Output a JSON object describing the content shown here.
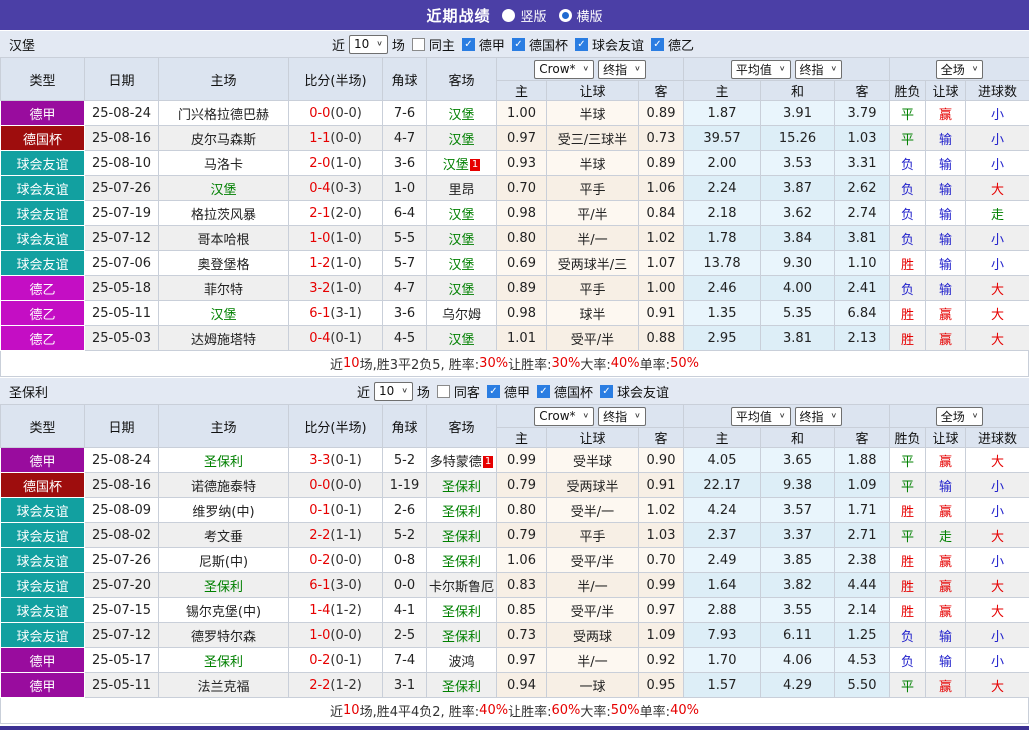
{
  "titlebar": {
    "title": "近期战绩",
    "radios": [
      {
        "label": "竖版",
        "checked": false
      },
      {
        "label": "横版",
        "checked": true
      }
    ]
  },
  "colors": {
    "topbar": "#4b3fa6",
    "type_colors": {
      "德甲": "#990c9e",
      "德国杯": "#9e0d0d",
      "球会友谊": "#12a0a0",
      "德乙": "#c40ec4"
    },
    "value_colors": {
      "胜": "#e60000",
      "平": "#008000",
      "负": "#2323cc",
      "赢": "#e60000",
      "输": "#2323cc",
      "走": "#008000",
      "大": "#e60000",
      "小": "#2323cc"
    },
    "team_link": "#008000",
    "score_ft": "#e60000",
    "summary_red": "#e60000"
  },
  "filter_labels": {
    "near": "近",
    "count": "10",
    "games": "场"
  },
  "column_headers": {
    "type": "类型",
    "date": "日期",
    "home": "主场",
    "score": "比分(半场)",
    "corner": "角球",
    "away": "客场",
    "odds_sub": [
      "主",
      "让球",
      "客"
    ],
    "avg_sub": [
      "主",
      "和",
      "客"
    ],
    "full_sub": [
      "胜负",
      "让球",
      "进球数"
    ]
  },
  "dropdowns": {
    "odds_a": "Crow*",
    "odds_b": "终指",
    "avg_a": "平均值",
    "avg_b": "终指",
    "full": "全场"
  },
  "sections": [
    {
      "team": "汉堡",
      "same_checkbox": {
        "label": "同主",
        "checked": false
      },
      "league_checkboxes": [
        {
          "label": "德甲",
          "checked": true
        },
        {
          "label": "德国杯",
          "checked": true
        },
        {
          "label": "球会友谊",
          "checked": true
        },
        {
          "label": "德乙",
          "checked": true
        }
      ],
      "rows": [
        {
          "type": "德甲",
          "date": "25-08-24",
          "home": "门兴格拉德巴赫",
          "home_team": false,
          "ft": "0-0",
          "ht": "(0-0)",
          "corner": "7-6",
          "away": "汉堡",
          "away_team": true,
          "away_card": "",
          "odds": [
            "1.00",
            "半球",
            "0.89"
          ],
          "avg": [
            "1.87",
            "3.91",
            "3.79"
          ],
          "full": [
            "平",
            "赢",
            "小"
          ]
        },
        {
          "type": "德国杯",
          "date": "25-08-16",
          "home": "皮尔马森斯",
          "home_team": false,
          "ft": "1-1",
          "ht": "(0-0)",
          "corner": "4-7",
          "away": "汉堡",
          "away_team": true,
          "away_card": "",
          "odds": [
            "0.97",
            "受三/三球半",
            "0.73"
          ],
          "avg": [
            "39.57",
            "15.26",
            "1.03"
          ],
          "full": [
            "平",
            "输",
            "小"
          ]
        },
        {
          "type": "球会友谊",
          "date": "25-08-10",
          "home": "马洛卡",
          "home_team": false,
          "ft": "2-0",
          "ht": "(1-0)",
          "corner": "3-6",
          "away": "汉堡",
          "away_team": true,
          "away_card": "1",
          "odds": [
            "0.93",
            "半球",
            "0.89"
          ],
          "avg": [
            "2.00",
            "3.53",
            "3.31"
          ],
          "full": [
            "负",
            "输",
            "小"
          ]
        },
        {
          "type": "球会友谊",
          "date": "25-07-26",
          "home": "汉堡",
          "home_team": true,
          "ft": "0-4",
          "ht": "(0-3)",
          "corner": "1-0",
          "away": "里昂",
          "away_team": false,
          "away_card": "",
          "odds": [
            "0.70",
            "平手",
            "1.06"
          ],
          "avg": [
            "2.24",
            "3.87",
            "2.62"
          ],
          "full": [
            "负",
            "输",
            "大"
          ]
        },
        {
          "type": "球会友谊",
          "date": "25-07-19",
          "home": "格拉茨风暴",
          "home_team": false,
          "ft": "2-1",
          "ht": "(2-0)",
          "corner": "6-4",
          "away": "汉堡",
          "away_team": true,
          "away_card": "",
          "odds": [
            "0.98",
            "平/半",
            "0.84"
          ],
          "avg": [
            "2.18",
            "3.62",
            "2.74"
          ],
          "full": [
            "负",
            "输",
            "走"
          ]
        },
        {
          "type": "球会友谊",
          "date": "25-07-12",
          "home": "哥本哈根",
          "home_team": false,
          "ft": "1-0",
          "ht": "(1-0)",
          "corner": "5-5",
          "away": "汉堡",
          "away_team": true,
          "away_card": "",
          "odds": [
            "0.80",
            "半/一",
            "1.02"
          ],
          "avg": [
            "1.78",
            "3.84",
            "3.81"
          ],
          "full": [
            "负",
            "输",
            "小"
          ]
        },
        {
          "type": "球会友谊",
          "date": "25-07-06",
          "home": "奥登堡格",
          "home_team": false,
          "ft": "1-2",
          "ht": "(1-0)",
          "corner": "5-7",
          "away": "汉堡",
          "away_team": true,
          "away_card": "",
          "odds": [
            "0.69",
            "受两球半/三",
            "1.07"
          ],
          "avg": [
            "13.78",
            "9.30",
            "1.10"
          ],
          "full": [
            "胜",
            "输",
            "小"
          ]
        },
        {
          "type": "德乙",
          "date": "25-05-18",
          "home": "菲尔特",
          "home_team": false,
          "ft": "3-2",
          "ht": "(1-0)",
          "corner": "4-7",
          "away": "汉堡",
          "away_team": true,
          "away_card": "",
          "odds": [
            "0.89",
            "平手",
            "1.00"
          ],
          "avg": [
            "2.46",
            "4.00",
            "2.41"
          ],
          "full": [
            "负",
            "输",
            "大"
          ]
        },
        {
          "type": "德乙",
          "date": "25-05-11",
          "home": "汉堡",
          "home_team": true,
          "ft": "6-1",
          "ht": "(3-1)",
          "corner": "3-6",
          "away": "乌尔姆",
          "away_team": false,
          "away_card": "",
          "odds": [
            "0.98",
            "球半",
            "0.91"
          ],
          "avg": [
            "1.35",
            "5.35",
            "6.84"
          ],
          "full": [
            "胜",
            "赢",
            "大"
          ]
        },
        {
          "type": "德乙",
          "date": "25-05-03",
          "home": "达姆施塔特",
          "home_team": false,
          "ft": "0-4",
          "ht": "(0-1)",
          "corner": "4-5",
          "away": "汉堡",
          "away_team": true,
          "away_card": "",
          "odds": [
            "1.01",
            "受平/半",
            "0.88"
          ],
          "avg": [
            "2.95",
            "3.81",
            "2.13"
          ],
          "full": [
            "胜",
            "赢",
            "大"
          ]
        }
      ],
      "summary": [
        {
          "t": "近",
          "red": false
        },
        {
          "t": "10",
          "red": true
        },
        {
          "t": "场,胜3平2负5, 胜率:",
          "red": false
        },
        {
          "t": "30%",
          "red": true
        },
        {
          "t": " 让胜率:",
          "red": false
        },
        {
          "t": "30%",
          "red": true
        },
        {
          "t": " 大率:",
          "red": false
        },
        {
          "t": "40%",
          "red": true
        },
        {
          "t": " 单率:",
          "red": false
        },
        {
          "t": "50%",
          "red": true
        }
      ]
    },
    {
      "team": "圣保利",
      "same_checkbox": {
        "label": "同客",
        "checked": false
      },
      "league_checkboxes": [
        {
          "label": "德甲",
          "checked": true
        },
        {
          "label": "德国杯",
          "checked": true
        },
        {
          "label": "球会友谊",
          "checked": true
        }
      ],
      "rows": [
        {
          "type": "德甲",
          "date": "25-08-24",
          "home": "圣保利",
          "home_team": true,
          "ft": "3-3",
          "ht": "(0-1)",
          "corner": "5-2",
          "away": "多特蒙德",
          "away_team": false,
          "away_card": "1",
          "odds": [
            "0.99",
            "受半球",
            "0.90"
          ],
          "avg": [
            "4.05",
            "3.65",
            "1.88"
          ],
          "full": [
            "平",
            "赢",
            "大"
          ]
        },
        {
          "type": "德国杯",
          "date": "25-08-16",
          "home": "诺德施泰特",
          "home_team": false,
          "ft": "0-0",
          "ht": "(0-0)",
          "corner": "1-19",
          "away": "圣保利",
          "away_team": true,
          "away_card": "",
          "odds": [
            "0.79",
            "受两球半",
            "0.91"
          ],
          "avg": [
            "22.17",
            "9.38",
            "1.09"
          ],
          "full": [
            "平",
            "输",
            "小"
          ]
        },
        {
          "type": "球会友谊",
          "date": "25-08-09",
          "home": "维罗纳(中)",
          "home_team": false,
          "ft": "0-1",
          "ht": "(0-1)",
          "corner": "2-6",
          "away": "圣保利",
          "away_team": true,
          "away_card": "",
          "odds": [
            "0.80",
            "受半/一",
            "1.02"
          ],
          "avg": [
            "4.24",
            "3.57",
            "1.71"
          ],
          "full": [
            "胜",
            "赢",
            "小"
          ]
        },
        {
          "type": "球会友谊",
          "date": "25-08-02",
          "home": "考文垂",
          "home_team": false,
          "ft": "2-2",
          "ht": "(1-1)",
          "corner": "5-2",
          "away": "圣保利",
          "away_team": true,
          "away_card": "",
          "odds": [
            "0.79",
            "平手",
            "1.03"
          ],
          "avg": [
            "2.37",
            "3.37",
            "2.71"
          ],
          "full": [
            "平",
            "走",
            "大"
          ]
        },
        {
          "type": "球会友谊",
          "date": "25-07-26",
          "home": "尼斯(中)",
          "home_team": false,
          "ft": "0-2",
          "ht": "(0-0)",
          "corner": "0-8",
          "away": "圣保利",
          "away_team": true,
          "away_card": "",
          "odds": [
            "1.06",
            "受平/半",
            "0.70"
          ],
          "avg": [
            "2.49",
            "3.85",
            "2.38"
          ],
          "full": [
            "胜",
            "赢",
            "小"
          ]
        },
        {
          "type": "球会友谊",
          "date": "25-07-20",
          "home": "圣保利",
          "home_team": true,
          "ft": "6-1",
          "ht": "(3-0)",
          "corner": "0-0",
          "away": "卡尔斯鲁厄",
          "away_team": false,
          "away_card": "",
          "odds": [
            "0.83",
            "半/一",
            "0.99"
          ],
          "avg": [
            "1.64",
            "3.82",
            "4.44"
          ],
          "full": [
            "胜",
            "赢",
            "大"
          ]
        },
        {
          "type": "球会友谊",
          "date": "25-07-15",
          "home": "锡尔克堡(中)",
          "home_team": false,
          "ft": "1-4",
          "ht": "(1-2)",
          "corner": "4-1",
          "away": "圣保利",
          "away_team": true,
          "away_card": "",
          "odds": [
            "0.85",
            "受平/半",
            "0.97"
          ],
          "avg": [
            "2.88",
            "3.55",
            "2.14"
          ],
          "full": [
            "胜",
            "赢",
            "大"
          ]
        },
        {
          "type": "球会友谊",
          "date": "25-07-12",
          "home": "德罗特尔森",
          "home_team": false,
          "ft": "1-0",
          "ht": "(0-0)",
          "corner": "2-5",
          "away": "圣保利",
          "away_team": true,
          "away_card": "",
          "odds": [
            "0.73",
            "受两球",
            "1.09"
          ],
          "avg": [
            "7.93",
            "6.11",
            "1.25"
          ],
          "full": [
            "负",
            "输",
            "小"
          ]
        },
        {
          "type": "德甲",
          "date": "25-05-17",
          "home": "圣保利",
          "home_team": true,
          "ft": "0-2",
          "ht": "(0-1)",
          "corner": "7-4",
          "away": "波鸿",
          "away_team": false,
          "away_card": "",
          "odds": [
            "0.97",
            "半/一",
            "0.92"
          ],
          "avg": [
            "1.70",
            "4.06",
            "4.53"
          ],
          "full": [
            "负",
            "输",
            "小"
          ]
        },
        {
          "type": "德甲",
          "date": "25-05-11",
          "home": "法兰克福",
          "home_team": false,
          "ft": "2-2",
          "ht": "(1-2)",
          "corner": "3-1",
          "away": "圣保利",
          "away_team": true,
          "away_card": "",
          "odds": [
            "0.94",
            "一球",
            "0.95"
          ],
          "avg": [
            "1.57",
            "4.29",
            "5.50"
          ],
          "full": [
            "平",
            "赢",
            "大"
          ]
        }
      ],
      "summary": [
        {
          "t": "近",
          "red": false
        },
        {
          "t": "10",
          "red": true
        },
        {
          "t": "场,胜4平4负2, 胜率:",
          "red": false
        },
        {
          "t": "40%",
          "red": true
        },
        {
          "t": " 让胜率:",
          "red": false
        },
        {
          "t": "60%",
          "red": true
        },
        {
          "t": " 大率:",
          "red": false
        },
        {
          "t": "50%",
          "red": true
        },
        {
          "t": " 单率:",
          "red": false
        },
        {
          "t": "40%",
          "red": true
        }
      ]
    }
  ]
}
